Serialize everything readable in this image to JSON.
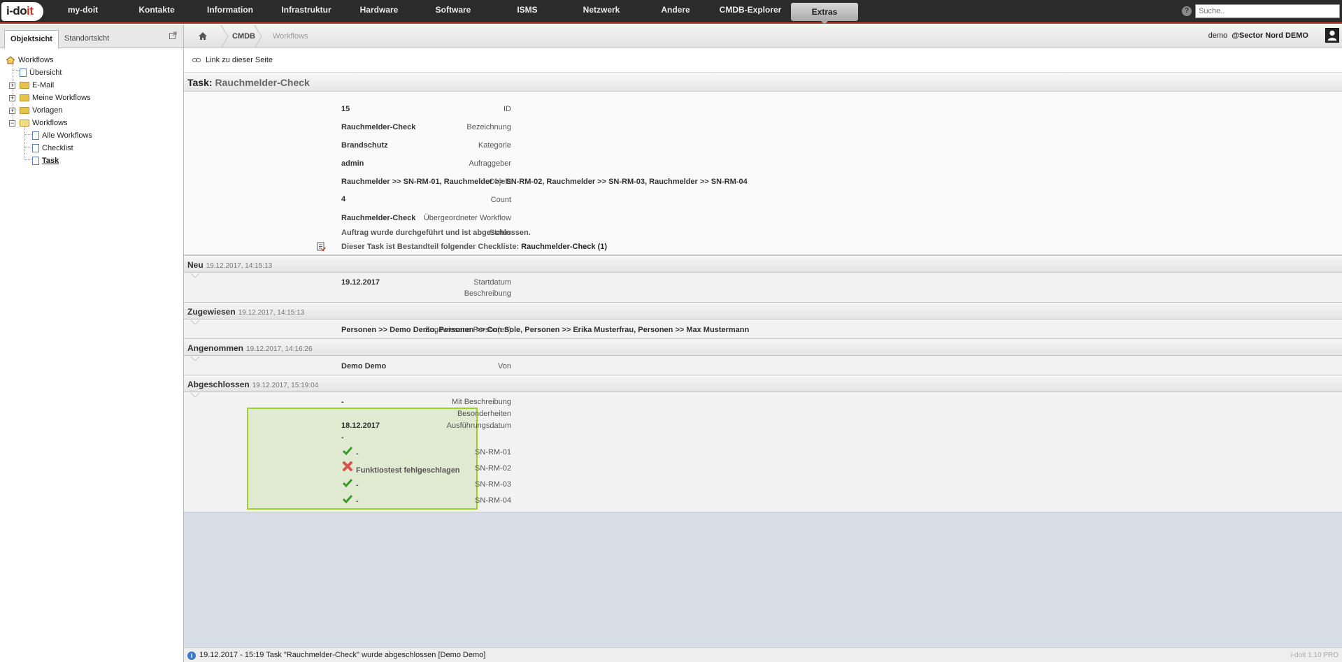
{
  "nav": {
    "logo": "i-doit",
    "items": [
      "my-doit",
      "Kontakte",
      "Information",
      "Infrastruktur",
      "Hardware",
      "Software",
      "ISMS",
      "Netzwerk",
      "Andere",
      "CMDB-Explorer",
      "Extras"
    ],
    "active": "Extras",
    "search_placeholder": "Suche.."
  },
  "left": {
    "tabs": [
      "Objektsicht",
      "Standortsicht"
    ],
    "tree": {
      "root": "Workflows",
      "uebersicht": "Übersicht",
      "email": "E-Mail",
      "meine": "Meine Workflows",
      "vorlagen": "Vorlagen",
      "workflows": "Workflows",
      "alle": "Alle Workflows",
      "checklist": "Checklist",
      "task": "Task"
    }
  },
  "breadcrumb": {
    "items": [
      "CMDB",
      "Workflows"
    ],
    "user": "demo",
    "tenant": "@Sector Nord DEMO"
  },
  "link_label": "Link zu dieser Seite",
  "task": {
    "prefix": "Task:",
    "name": "Rauchmelder-Check"
  },
  "info": {
    "id_label": "ID",
    "id": "15",
    "bez_label": "Bezeichnung",
    "bez": "Rauchmelder-Check",
    "kat_label": "Kategorie",
    "kat": "Brandschutz",
    "auf_label": "Aufraggeber",
    "auf": "admin",
    "obj_label": "Objekt",
    "obj": "Rauchmelder >> SN-RM-01, Rauchmelder >> SN-RM-02, Rauchmelder >> SN-RM-03, Rauchmelder >> SN-RM-04",
    "count_label": "Count",
    "count": "4",
    "parent_label": "Übergeordneter Workflow",
    "parent": "Rauchmelder-Check",
    "status_label": "Status",
    "status": "Auftrag wurde durchgeführt und ist abgeschlossen.",
    "checklist_text": "Dieser Task ist Bestandteil folgender Checkliste:",
    "checklist_name": "Rauchmelder-Check (1)"
  },
  "sections": {
    "neu": {
      "title": "Neu",
      "time": "19.12.2017, 14:15:13",
      "start_label": "Startdatum",
      "start": "19.12.2017",
      "desc_label": "Beschreibung"
    },
    "zugewiesen": {
      "title": "Zugewiesen",
      "time": "19.12.2017, 14:15:13",
      "persons_label": "Zugewiesene Person(en)",
      "persons": "Personen >> Demo Demo, Personen >> Con Sole, Personen >> Erika Musterfrau, Personen >> Max Mustermann"
    },
    "angenommen": {
      "title": "Angenommen",
      "time": "19.12.2017, 14:16:26",
      "von_label": "Von",
      "von": "Demo Demo"
    },
    "abgeschlossen": {
      "title": "Abgeschlossen",
      "time": "19.12.2017, 15:19:04",
      "mit_label": "Mit Beschreibung",
      "mit": "-",
      "bes_label": "Besonderheiten",
      "aus_label": "Ausführungsdatum",
      "aus": "18.12.2017",
      "dash": "-",
      "items": [
        {
          "name": "SN-RM-01",
          "ok": true,
          "text": "-"
        },
        {
          "name": "SN-RM-02",
          "ok": false,
          "text": "Funktiostest fehlgeschlagen"
        },
        {
          "name": "SN-RM-03",
          "ok": true,
          "text": "-"
        },
        {
          "name": "SN-RM-04",
          "ok": true,
          "text": "-"
        }
      ]
    }
  },
  "status_bar": {
    "message": "19.12.2017 - 15:19 Task \"Rauchmelder-Check\" wurde abgeschlossen [Demo Demo]",
    "version": "i-doit 1.10 PRO"
  },
  "colors": {
    "nav_bg": "#2b2b2b",
    "accent": "#c0392b",
    "highlight_border": "#9bd12c",
    "highlight_bg": "#e0ead0",
    "ok": "#3a9a2a",
    "fail": "#d9534f"
  }
}
